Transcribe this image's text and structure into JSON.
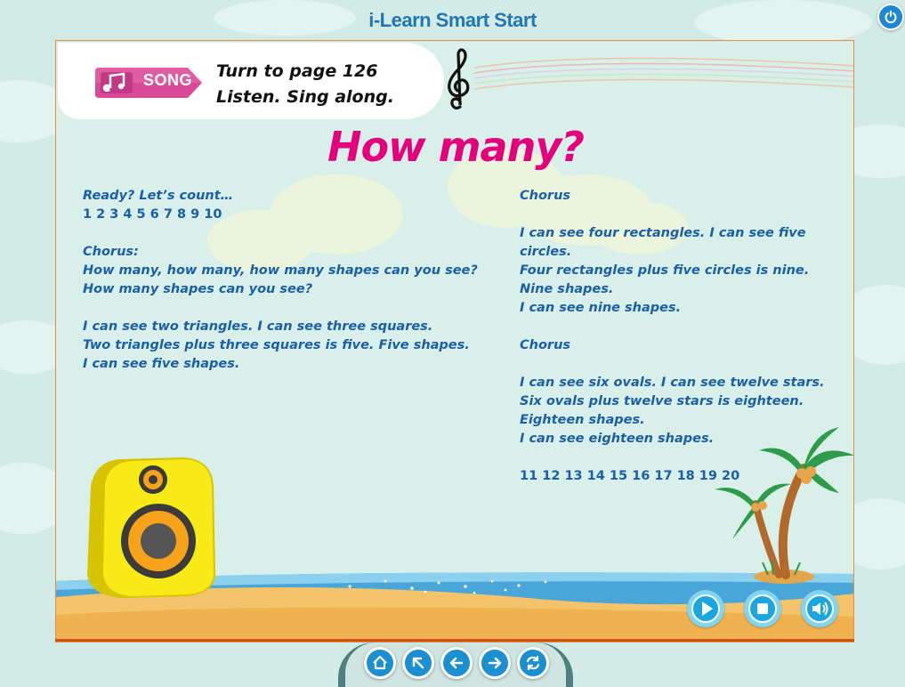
{
  "app": {
    "title": "i-Learn Smart Start"
  },
  "header": {
    "tag_label": "SONG",
    "instruction_line1": "Turn to page 126",
    "instruction_line2": "Listen. Sing along."
  },
  "song": {
    "title": "How many?",
    "left_column": [
      "Ready? Let’s count…",
      "1 2 3 4 5 6 7 8 9 10",
      "",
      "Chorus:",
      "How many, how many, how many shapes can you see?",
      "How many shapes can you see?",
      "",
      "I can see two triangles. I can see three squares.",
      "Two triangles plus three squares is five. Five shapes.",
      "I can see five shapes."
    ],
    "right_column": [
      "Chorus",
      "",
      "I can see four rectangles. I can see five",
      "circles.",
      "Four rectangles plus five circles is nine.",
      "Nine shapes.",
      "I can see nine shapes.",
      "",
      "Chorus",
      "",
      "I can see six ovals. I can see twelve stars.",
      "Six ovals plus twelve stars is eighteen.",
      "Eighteen shapes.",
      "I can see eighteen shapes.",
      "",
      "11 12 13 14 15 16 17 18 19 20"
    ]
  },
  "controls": {
    "play": "play-icon",
    "stop": "stop-icon",
    "volume": "volume-icon"
  },
  "nav": [
    "home-icon",
    "up-left-arrow-icon",
    "back-arrow-icon",
    "forward-arrow-icon",
    "refresh-icon"
  ],
  "colors": {
    "title_accent": "#e4007c",
    "lyrics": "#1a5fa8",
    "app_title": "#1f77b4",
    "button_blue": "#1ca6e0",
    "frame_border": "#f0893a",
    "song_tag": "#d84a97"
  }
}
